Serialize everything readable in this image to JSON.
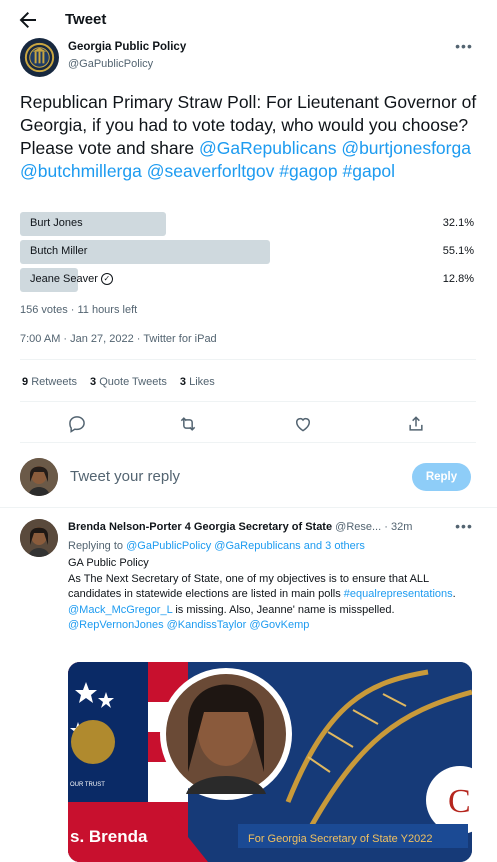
{
  "header": {
    "title": "Tweet",
    "back_icon": "arrow-left-icon"
  },
  "tweet": {
    "author_name": "Georgia Public Policy",
    "author_handle": "@GaPublicPolicy",
    "text_plain": "Republican Primary Straw Poll: For Lieutenant Governor of Georgia, if you had to vote today, who would you choose? Please vote and share",
    "text_links": "@GaRepublicans @burtjonesforga @butchmillerga @seaverforltgov #gagop #gapol",
    "poll": {
      "options": [
        {
          "label": "Burt Jones",
          "percent": "32.1%",
          "fraction": 0.321,
          "verified": false
        },
        {
          "label": "Butch Miller",
          "percent": "55.1%",
          "fraction": 0.551,
          "verified": false
        },
        {
          "label": "Jeane Seaver",
          "percent": "12.8%",
          "fraction": 0.128,
          "verified": true
        }
      ],
      "meta": "156 votes · 11 hours left"
    },
    "timestamp": "7:00 AM · Jan 27, 2022 · Twitter for iPad",
    "stats": {
      "retweets_count": "9",
      "retweets_label": "Retweets",
      "quotes_count": "3",
      "quotes_label": "Quote Tweets",
      "likes_count": "3",
      "likes_label": "Likes"
    }
  },
  "composer": {
    "placeholder": "Tweet your reply",
    "button": "Reply"
  },
  "reply": {
    "author_name": "Brenda Nelson-Porter 4 Georgia Secretary of State",
    "author_handle": "@Rese...",
    "time": "· 32m",
    "replying_prefix": "Replying to",
    "replying_to": "@GaPublicPolicy @GaRepublicans and 3 others",
    "line1": "GA Public Policy",
    "line2": "As The Next Secretary of State, one of my objectives is to ensure that ALL candidates in statewide elections are listed in main polls",
    "tag": "#equalrepresentations",
    "mention": "@Mack_McGregor_L",
    "line3": "is missing. Also, Jeanne' name is misspelled.",
    "mentions_last": "@RepVernonJones @KandissTaylor @GovKemp",
    "media_banner": "For Georgia Secretary of State Y2022",
    "media_name": "s. Brenda",
    "media_badge_text": "OUR TRUST",
    "media_logo_letter": "C"
  }
}
